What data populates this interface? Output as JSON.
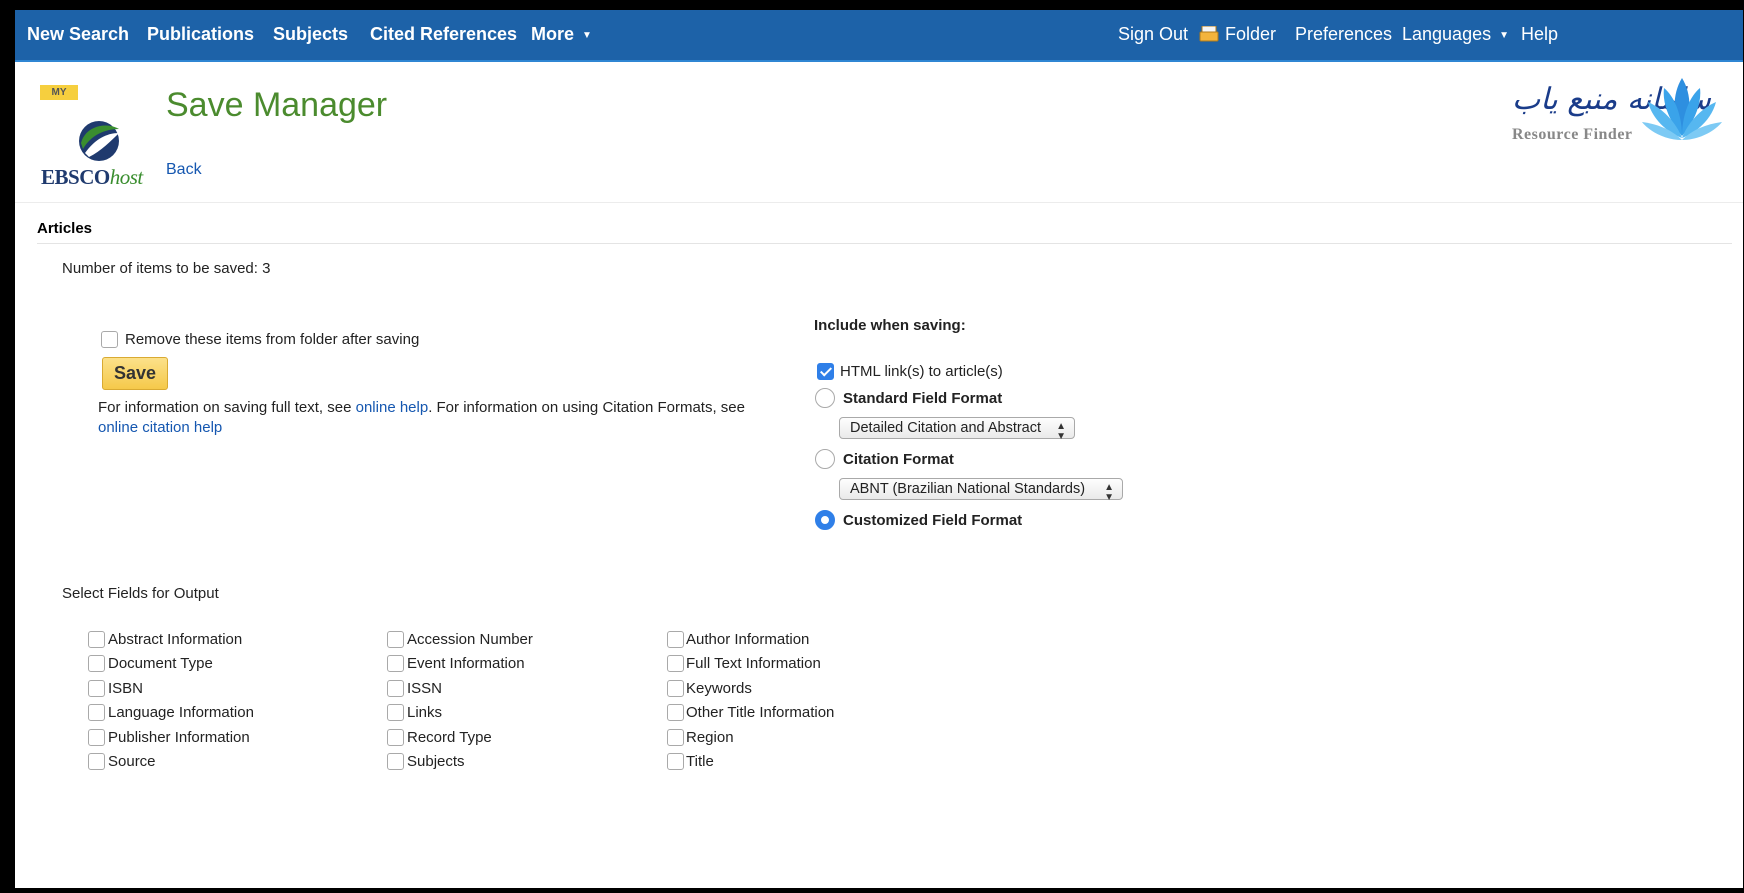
{
  "nav": {
    "left": [
      {
        "label": "New Search"
      },
      {
        "label": "Publications"
      },
      {
        "label": "Subjects"
      },
      {
        "label": "Cited References"
      },
      {
        "label": "More"
      }
    ],
    "right": [
      {
        "label": "Sign Out"
      },
      {
        "label": "Folder"
      },
      {
        "label": "Preferences"
      },
      {
        "label": "Languages"
      },
      {
        "label": "Help"
      }
    ]
  },
  "header": {
    "my_badge": "MY",
    "brand_main": "EBSCO",
    "brand_suffix": "host",
    "title": "Save Manager",
    "back": "Back",
    "partner_arabic": "سامانه منبع یاب",
    "partner_english": "Resource Finder"
  },
  "section": {
    "heading": "Articles",
    "items_count": "Number of items to be saved: 3",
    "remove_label": "Remove these items from folder after saving",
    "remove_checked": false,
    "save_label": "Save",
    "help": {
      "t1": "For information on saving full text, see ",
      "link1": "online help",
      "t2": ". For information on using Citation Formats, see ",
      "link2": "online citation help"
    }
  },
  "include": {
    "heading": "Include when saving:",
    "html_links_label": "HTML link(s) to article(s)",
    "html_links_checked": true,
    "standard_label": "Standard Field Format",
    "standard_select": "Detailed Citation and Abstract",
    "citation_label": "Citation Format",
    "citation_select": "ABNT (Brazilian National Standards)",
    "custom_label": "Customized Field Format",
    "selected_format": "Customized Field Format"
  },
  "fields": {
    "heading": "Select Fields for Output",
    "columns": [
      [
        "Abstract Information",
        "Document Type",
        "ISBN",
        "Language Information",
        "Publisher Information",
        "Source"
      ],
      [
        "Accession Number",
        "Event Information",
        "ISSN",
        "Links",
        "Record Type",
        "Subjects"
      ],
      [
        "Author Information",
        "Full Text Information",
        "Keywords",
        "Other Title Information",
        "Region",
        "Title"
      ]
    ]
  },
  "colors": {
    "nav_bg": "#1d62a8",
    "title_green": "#4b8b2e",
    "link_blue": "#1557b0",
    "accent_blue": "#2f7fe8",
    "save_yellow": "#f5c94a"
  }
}
